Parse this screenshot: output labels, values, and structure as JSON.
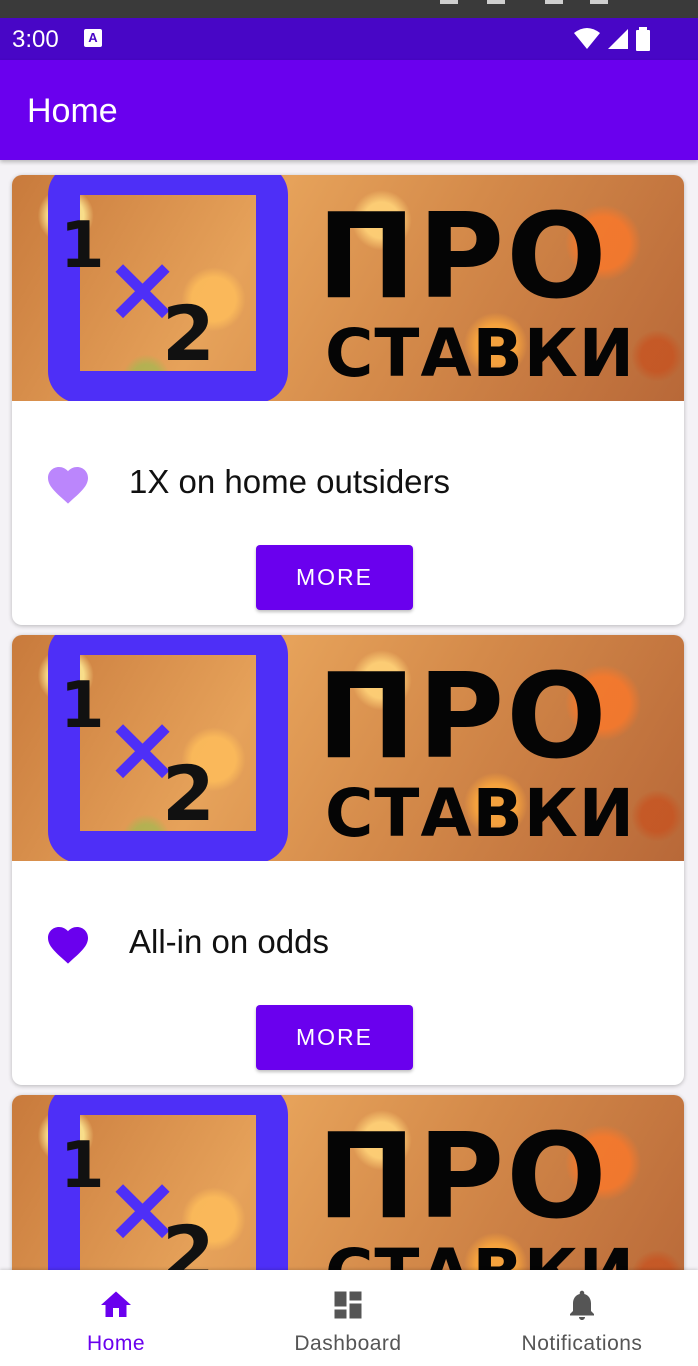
{
  "status_bar": {
    "time": "3:00",
    "notification_badge": "A",
    "icons": [
      "wifi-icon",
      "signal-icon",
      "battery-icon"
    ]
  },
  "app_bar": {
    "title": "Home"
  },
  "cards": [
    {
      "banner": {
        "logo_top": "1",
        "logo_mid": "×",
        "logo_bottom": "2",
        "line1": "ПРО",
        "line2": "СТАВКИ"
      },
      "title": "1X on home outsiders",
      "favorite": false,
      "more_label": "MORE"
    },
    {
      "banner": {
        "logo_top": "1",
        "logo_mid": "×",
        "logo_bottom": "2",
        "line1": "ПРО",
        "line2": "СТАВКИ"
      },
      "title": "All-in on odds",
      "favorite": true,
      "more_label": "MORE"
    },
    {
      "banner": {
        "logo_top": "1",
        "logo_mid": "×",
        "logo_bottom": "2",
        "line1": "ПРО",
        "line2": "СТАВКИ"
      }
    }
  ],
  "bottom_nav": {
    "items": [
      {
        "label": "Home",
        "icon": "home-icon",
        "active": true
      },
      {
        "label": "Dashboard",
        "icon": "dashboard-icon",
        "active": false
      },
      {
        "label": "Notifications",
        "icon": "bell-icon",
        "active": false
      }
    ]
  },
  "colors": {
    "primary": "#6a00ee",
    "status_bar": "#4806c6",
    "heart_favorite": "#6a00ee",
    "heart_not_favorite": "#bb86fc",
    "logo_blue": "#4e2ff7"
  }
}
